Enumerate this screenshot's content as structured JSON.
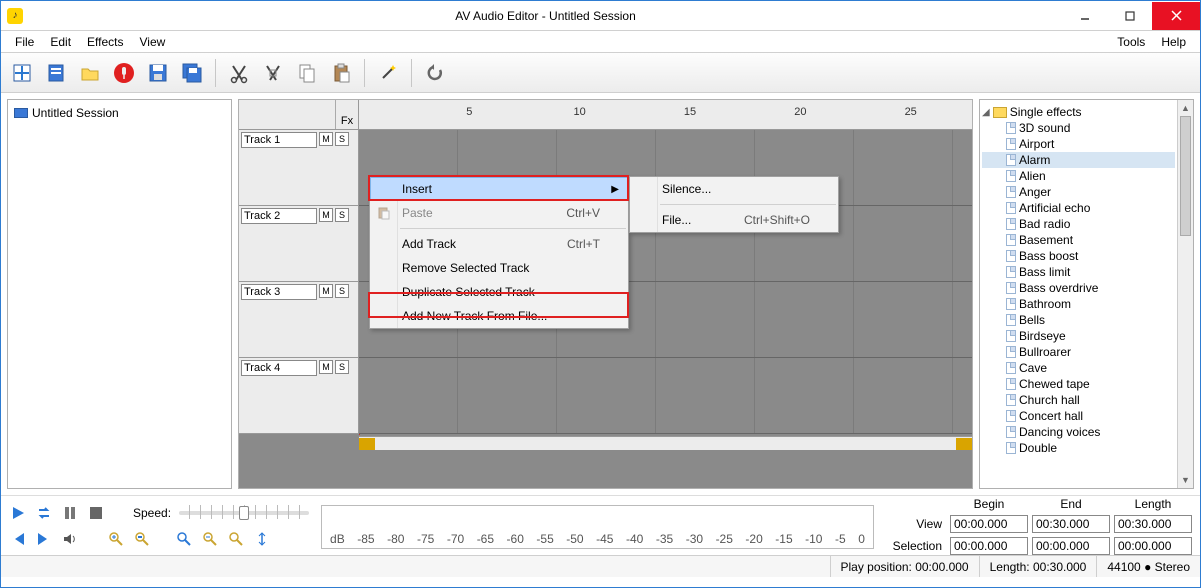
{
  "title": "AV Audio Editor - Untitled Session",
  "menubar": {
    "left": [
      "File",
      "Edit",
      "Effects",
      "View"
    ],
    "right": [
      "Tools",
      "Help"
    ]
  },
  "session_name": "Untitled Session",
  "fx_label": "Fx",
  "ruler": [
    "5",
    "10",
    "15",
    "20",
    "25"
  ],
  "tracks": [
    "Track 1",
    "Track 2",
    "Track 3",
    "Track 4"
  ],
  "track_btn_m": "M",
  "track_btn_s": "S",
  "effects_root": "Single effects",
  "effects": [
    "3D sound",
    "Airport",
    "Alarm",
    "Alien",
    "Anger",
    "Artificial echo",
    "Bad radio",
    "Basement",
    "Bass boost",
    "Bass limit",
    "Bass overdrive",
    "Bathroom",
    "Bells",
    "Birdseye",
    "Bullroarer",
    "Cave",
    "Chewed tape",
    "Church hall",
    "Concert hall",
    "Dancing voices",
    "Double"
  ],
  "effects_selected_index": 2,
  "context_menu": {
    "insert": "Insert",
    "paste": "Paste",
    "paste_shortcut": "Ctrl+V",
    "add_track": "Add Track",
    "add_track_shortcut": "Ctrl+T",
    "remove_track": "Remove Selected Track",
    "duplicate_track": "Duplicate Selected Track",
    "add_from_file": "Add New Track From File..."
  },
  "submenu": {
    "silence": "Silence...",
    "file": "File...",
    "file_shortcut": "Ctrl+Shift+O"
  },
  "speed_label": "Speed:",
  "db_values": [
    "dB",
    "-85",
    "-80",
    "-75",
    "-70",
    "-65",
    "-60",
    "-55",
    "-50",
    "-45",
    "-40",
    "-35",
    "-30",
    "-25",
    "-20",
    "-15",
    "-10",
    "-5",
    "0"
  ],
  "time_headers": {
    "begin": "Begin",
    "end": "End",
    "length": "Length"
  },
  "time_rows": {
    "view_label": "View",
    "view_begin": "00:00.000",
    "view_end": "00:30.000",
    "view_length": "00:30.000",
    "sel_label": "Selection",
    "sel_begin": "00:00.000",
    "sel_end": "00:00.000",
    "sel_length": "00:00.000"
  },
  "status": {
    "play_pos": "Play position: 00:00.000",
    "length": "Length: 00:30.000",
    "rate": "44100 ● Stereo"
  }
}
